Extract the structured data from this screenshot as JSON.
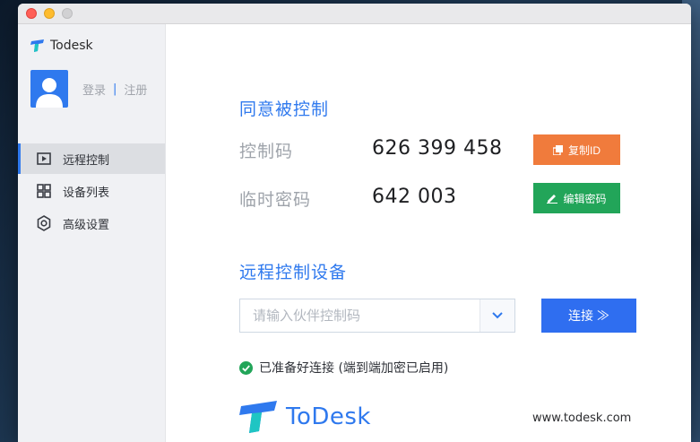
{
  "app": {
    "name": "Todesk"
  },
  "auth": {
    "login": "登录",
    "separator": "|",
    "register": "注册"
  },
  "nav": {
    "items": [
      {
        "label": "远程控制",
        "icon": "play-screen-icon",
        "active": true
      },
      {
        "label": "设备列表",
        "icon": "grid-icon",
        "active": false
      },
      {
        "label": "高级设置",
        "icon": "gear-icon",
        "active": false
      }
    ]
  },
  "allow": {
    "title": "同意被控制",
    "code_label": "控制码",
    "code_value": "626 399 458",
    "copy_label": "复制ID",
    "temp_label": "临时密码",
    "temp_value": "642 003",
    "edit_label": "编辑密码"
  },
  "remote": {
    "title": "远程控制设备",
    "input_placeholder": "请输入伙伴控制码",
    "input_value": "",
    "connect_label": "连接 ≫"
  },
  "status": {
    "text": "已准备好连接 (端到端加密已启用)"
  },
  "footer": {
    "logo_text": "ToDesk",
    "url": "www.todesk.com"
  },
  "colors": {
    "accent": "#2f79ee",
    "copy": "#f07b3c",
    "edit": "#22a559",
    "connect": "#2f6ef0"
  }
}
